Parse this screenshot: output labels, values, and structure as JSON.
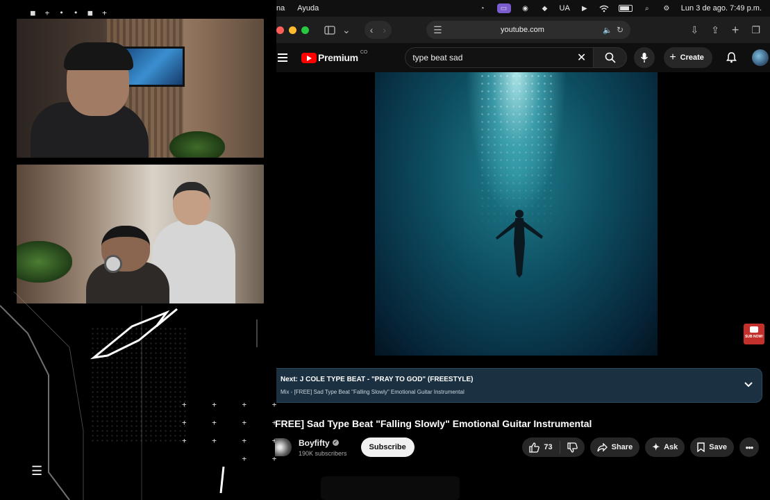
{
  "stream_overlay": {
    "menu_glyph": "☰"
  },
  "menubar": {
    "menu_items": [
      "na",
      "Ayuda"
    ],
    "input_language": "UA",
    "datetime": "Lun 3 de ago.  7:49 p.m."
  },
  "browser": {
    "url": "youtube.com",
    "traffic_colors": [
      "#ff5f57",
      "#febc2e",
      "#28c840"
    ]
  },
  "youtube": {
    "brand": "Premium",
    "country": "CO",
    "search_value": "type beat sad",
    "create_label": "Create",
    "accent": "#ff0000"
  },
  "video": {
    "sub_badge": "SUB NOW!"
  },
  "up_next": {
    "title": "Next: J COLE TYPE BEAT - \"PRAY TO GOD\" (FREESTYLE)",
    "subtitle": "Mix - [FREE] Sad Type Beat \"Falling Slowly\" Emotional Guitar Instrumental"
  },
  "watch": {
    "title": "FREE] Sad Type Beat \"Falling Slowly\" Emotional Guitar Instrumental",
    "channel_name": "Boyfifty",
    "subscribers": "190K subscribers",
    "subscribe_label": "Subscribe",
    "likes": "73",
    "share_label": "Share",
    "ask_label": "Ask",
    "save_label": "Save"
  }
}
